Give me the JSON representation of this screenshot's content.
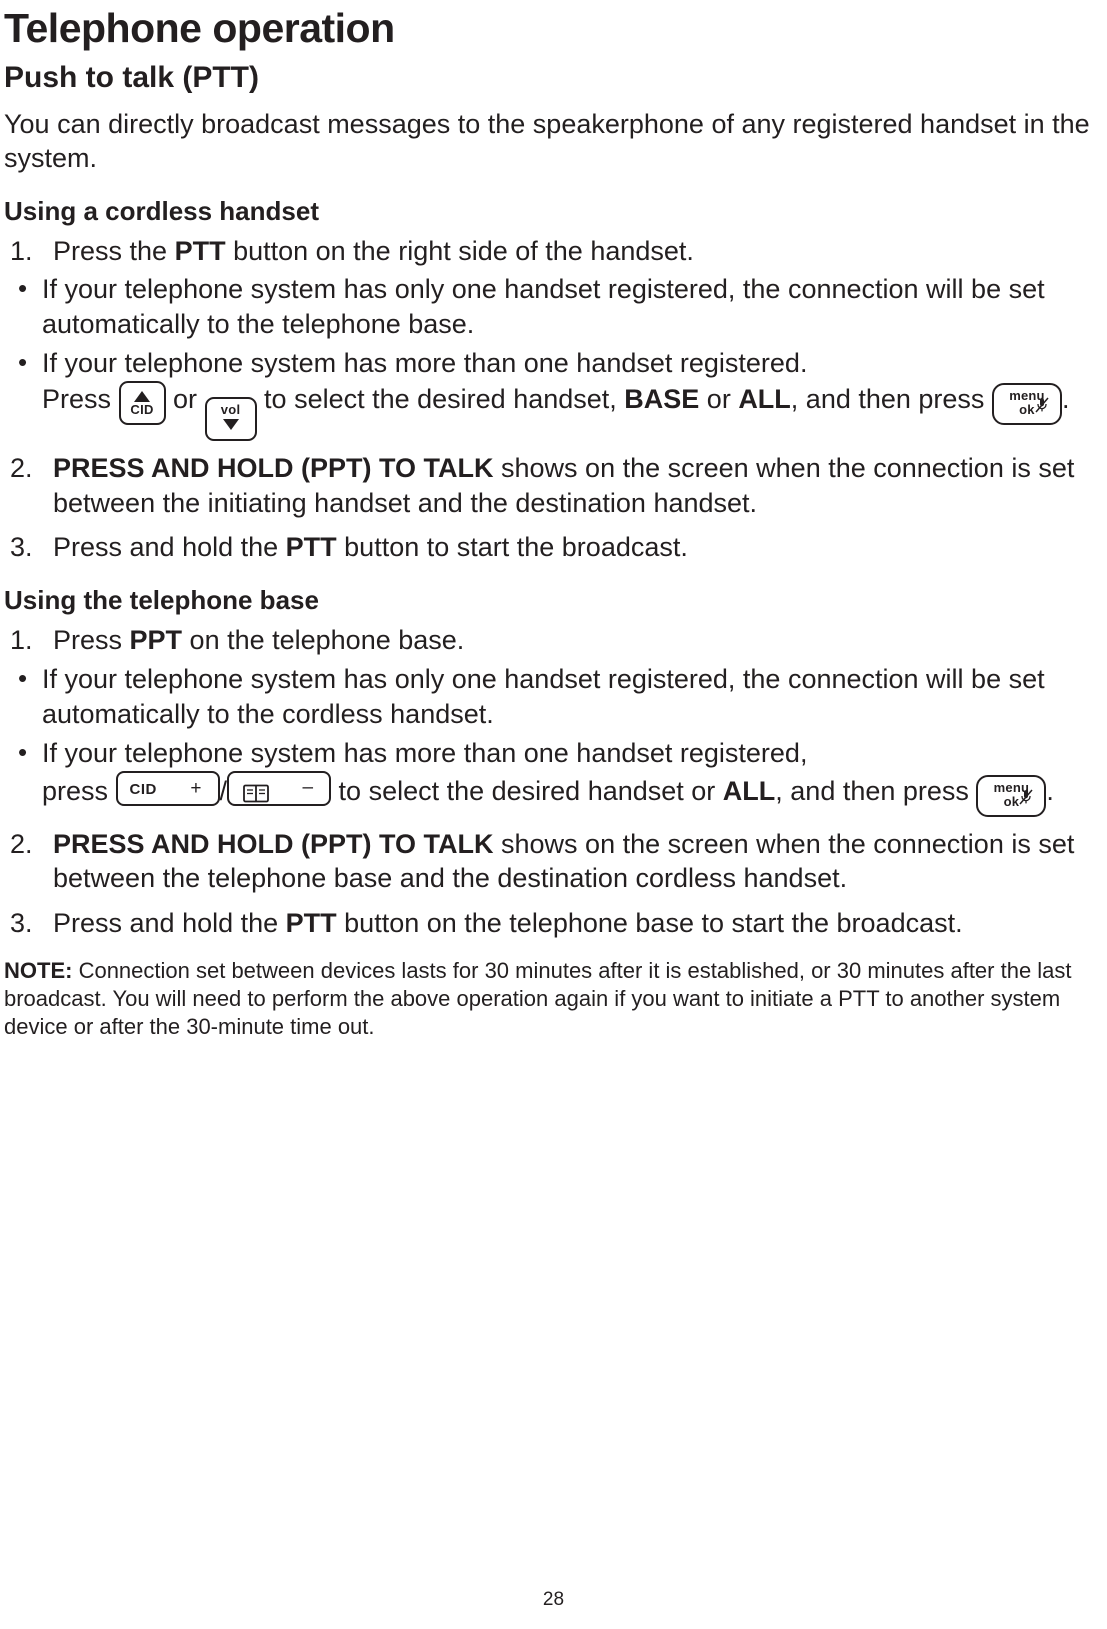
{
  "chapter": {
    "title": "Telephone operation"
  },
  "section": {
    "title": "Push to talk (PTT)"
  },
  "intro": "You can directly broadcast messages to the speakerphone of any registered handset in the system.",
  "subsection_handset": {
    "title": "Using a cordless handset"
  },
  "handset_steps": [
    {
      "num": "1.",
      "text_a": "Press the ",
      "bold_a": "PTT",
      "text_b": " button on the right side of the handset."
    },
    {
      "num": "2.",
      "bold_a": "PRESS AND HOLD (PPT) TO TALK",
      "text_b": " shows on the screen when the connection is set between the initiating handset and the destination handset."
    },
    {
      "num": "3.",
      "text_a": "Press and hold the ",
      "bold_a": "PTT",
      "text_b": " button to start the broadcast."
    }
  ],
  "handset_bullets": [
    {
      "dot": "•",
      "text": "If your telephone system has only one handset registered, the connection will be set automatically to the telephone base."
    },
    {
      "dot": "•",
      "line1": "If your telephone system has more than one handset registered.",
      "press": "Press ",
      "or": " or ",
      "select": " to select the desired handset, ",
      "base": "BASE",
      "or2": " or ",
      "all": "ALL",
      "comma_and": ", and then press ",
      "period": "."
    }
  ],
  "subsection_base": {
    "title": "Using the telephone base"
  },
  "base_steps": [
    {
      "num": "1.",
      "text_a": "Press ",
      "bold_a": "PPT",
      "text_b": " on the telephone base."
    },
    {
      "num": "2.",
      "bold_a": "PRESS AND HOLD (PPT) TO TALK",
      "text_b": " shows on the screen when the connection is set between the telephone base and the destination cordless handset."
    },
    {
      "num": "3.",
      "text_a": "Press and hold the ",
      "bold_a": "PTT",
      "text_b": " button on the telephone base to start the broadcast."
    }
  ],
  "base_bullets": [
    {
      "dot": "•",
      "text": "If your telephone system has only one handset registered, the connection will be set automatically to the cordless handset."
    },
    {
      "dot": "•",
      "line1": "If your telephone system has more than one handset registered,",
      "press": "press ",
      "slash": "/",
      "select": " to select the desired handset or ",
      "all": "ALL",
      "comma_and": ", and then press ",
      "period": "."
    }
  ],
  "keys": {
    "cid": "CID",
    "vol": "vol",
    "menu": "menu",
    "ok": "ok",
    "plus": "+",
    "minus": "–"
  },
  "note": {
    "label": "NOTE:",
    "text": " Connection set between devices lasts for 30 minutes after it is established, or 30 minutes after the last broadcast. You will need to perform the above operation again if you want to initiate a PTT to another system device or after the 30-minute time out."
  },
  "page_number": "28"
}
